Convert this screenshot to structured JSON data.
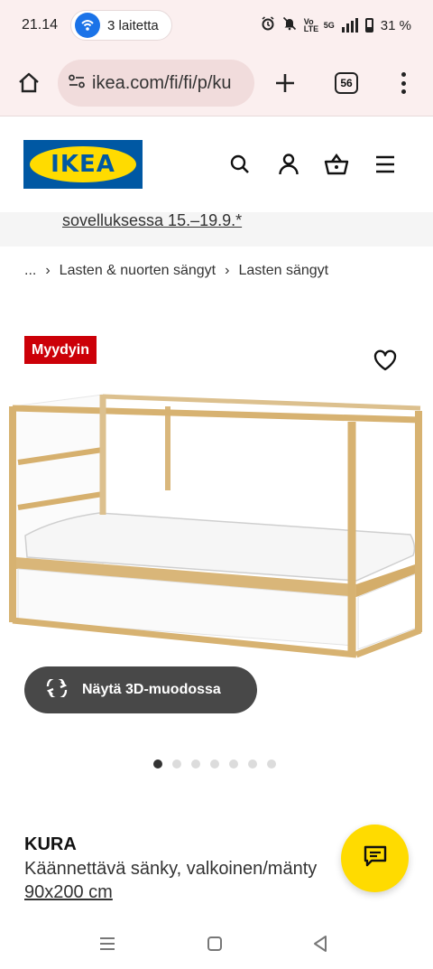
{
  "status_bar": {
    "time": "21.14",
    "hotspot_label": "3 laitetta",
    "network_label": "Vo LTE",
    "network_type": "5G",
    "battery_percent": "31 %"
  },
  "browser": {
    "url_text": "ikea.com/fi/fi/p/ku",
    "tab_count": "56"
  },
  "header": {
    "logo_text": "IKEA"
  },
  "promo": {
    "text": "sovelluksessa 15.–19.9.*"
  },
  "breadcrumb": {
    "items": [
      "...",
      "Lasten & nuorten sängyt",
      "Lasten sängyt"
    ]
  },
  "product": {
    "badge": "Myydyin",
    "view_3d_label": "Näytä 3D-muodossa",
    "name": "KURA",
    "description": "Käännettävä sänky, valkoinen/mänty",
    "size": "90x200 cm"
  },
  "gallery": {
    "image_count": 7,
    "active_index": 0
  },
  "colors": {
    "ikea_blue": "#0058a3",
    "ikea_yellow": "#ffdb00",
    "badge_red": "#cc0008",
    "button_dark": "#484848"
  }
}
